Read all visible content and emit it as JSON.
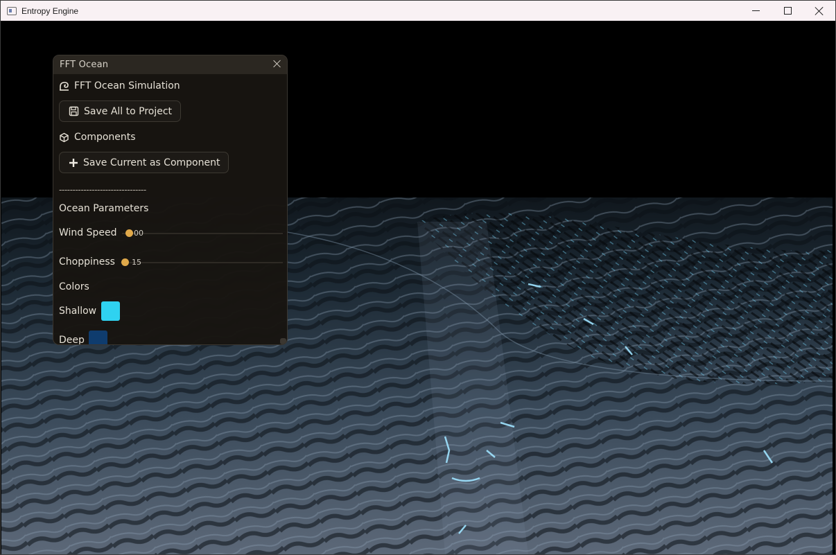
{
  "window": {
    "title": "Entropy Engine"
  },
  "panel": {
    "title": "FFT Ocean",
    "section_title": "FFT Ocean Simulation",
    "save_all_label": "Save All to Project",
    "components_header": "Components",
    "save_component_label": "Save Current as Component",
    "separator": "--------------------------------",
    "ocean_params_header": "Ocean Parameters",
    "wind_speed": {
      "label": "Wind Speed",
      "value": "00"
    },
    "choppiness": {
      "label": "Choppiness",
      "value": "15"
    },
    "colors_header": "Colors",
    "shallow": {
      "label": "Shallow",
      "color": "#2fd2f0"
    },
    "deep": {
      "label": "Deep",
      "color": "#0f3c6e"
    }
  },
  "colors": {
    "accent": "#e0a94a",
    "panel_bg": "#181511"
  }
}
